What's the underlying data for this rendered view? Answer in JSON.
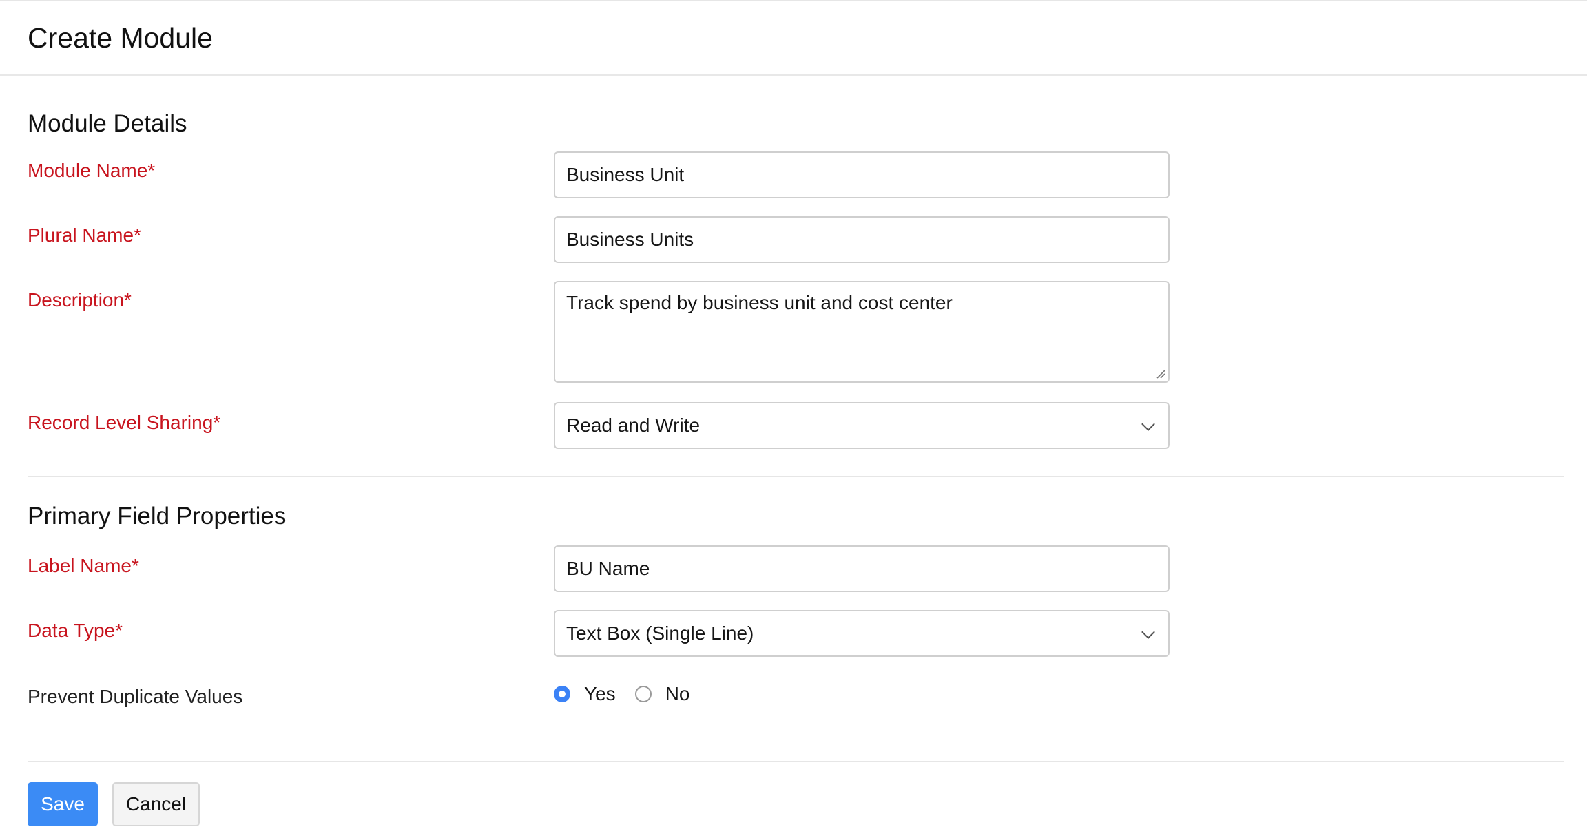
{
  "header": {
    "title": "Create Module"
  },
  "module_details": {
    "title": "Module Details",
    "module_name": {
      "label": "Module Name*",
      "value": "Business Unit"
    },
    "plural_name": {
      "label": "Plural Name*",
      "value": "Business Units"
    },
    "description": {
      "label": "Description*",
      "value": "Track spend by business unit and cost center"
    },
    "record_level_sharing": {
      "label": "Record Level Sharing*",
      "value": "Read and Write"
    }
  },
  "primary_field": {
    "title": "Primary Field Properties",
    "label_name": {
      "label": "Label Name*",
      "value": "BU Name"
    },
    "data_type": {
      "label": "Data Type*",
      "value": "Text Box (Single Line)"
    },
    "prevent_duplicates": {
      "label": "Prevent Duplicate Values",
      "options": [
        "Yes",
        "No"
      ],
      "selected": "Yes"
    }
  },
  "actions": {
    "save_label": "Save",
    "cancel_label": "Cancel"
  },
  "colors": {
    "required_label": "#c8141e",
    "primary_button": "#3b8bf5",
    "radio_checked": "#3b82f6"
  }
}
